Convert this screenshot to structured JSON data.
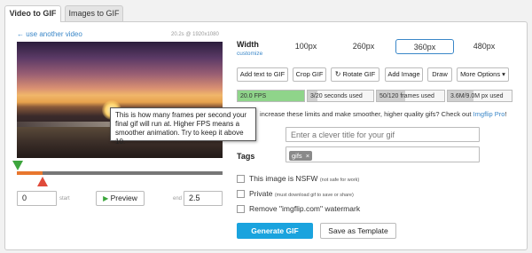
{
  "tabs": [
    {
      "label": "Video to GIF",
      "active": true
    },
    {
      "label": "Images to GIF",
      "active": false
    }
  ],
  "video": {
    "back_link": "← use another video",
    "info": "20.2s @ 1920x1080"
  },
  "tooltip": "This is how many frames per second your final gif will run at. Higher FPS means a smoother animation. Try to keep it above 10.",
  "timeline": {
    "start_value": "0",
    "start_label": "start",
    "preview_label": "Preview",
    "end_label": "end",
    "end_value": "2.5",
    "selection_fraction": 0.124
  },
  "width": {
    "label": "Width",
    "customize": "customize",
    "options": [
      "100px",
      "260px",
      "360px",
      "480px"
    ],
    "selected": "360px"
  },
  "toolbar": {
    "add_text": "Add text to GIF",
    "crop": "Crop GIF",
    "rotate": "Rotate GIF",
    "add_image": "Add Image",
    "draw": "Draw",
    "more_options": "More Options ▾"
  },
  "stats": [
    {
      "label": "20.0 FPS",
      "fill": 1.0,
      "color": "#8fd48a"
    },
    {
      "label": "3/20 seconds used",
      "fill": 0.15,
      "color": "#cfcfcf"
    },
    {
      "label": "50/120 frames used",
      "fill": 0.42,
      "color": "#cfcfcf"
    },
    {
      "label": "3.6M/9.0M px used",
      "fill": 0.4,
      "color": "#cfcfcf"
    }
  ],
  "upgrade": {
    "text": "increase these limits and make smoother, higher quality gifs? Check out",
    "link": "Imgflip Pro",
    "suffix": "!"
  },
  "title_field": {
    "placeholder": "Enter a clever title for your gif"
  },
  "tags": {
    "label": "Tags",
    "items": [
      {
        "text": "gifs",
        "remove": "×"
      }
    ]
  },
  "options": [
    {
      "label": "This image is NSFW",
      "note": "(not safe for work)"
    },
    {
      "label": "Private",
      "note": "(must download gif to save or share)"
    },
    {
      "label": "Remove \"imgflip.com\" watermark",
      "note": ""
    }
  ],
  "actions": {
    "generate": "Generate GIF",
    "template": "Save as Template"
  },
  "colors": {
    "accent": "#1aa3de",
    "link": "#3a87c8",
    "start_marker": "#3da53d",
    "end_marker": "#e04a3a",
    "selection": "#e8772e"
  }
}
